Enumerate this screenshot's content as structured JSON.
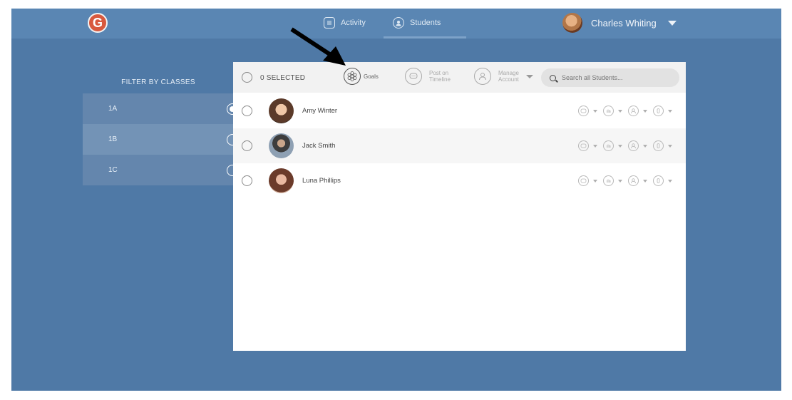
{
  "app": {
    "logo_letter": "G"
  },
  "nav": {
    "activity": {
      "label": "Activity",
      "icon": "list-icon"
    },
    "students": {
      "label": "Students",
      "icon": "user-icon",
      "active": true
    }
  },
  "user": {
    "name": "Charles Whiting"
  },
  "filter": {
    "title": "FILTER BY CLASSES",
    "classes": [
      {
        "label": "1A",
        "selected": true
      },
      {
        "label": "1B",
        "selected": false
      },
      {
        "label": "1C",
        "selected": false
      }
    ]
  },
  "toolbar": {
    "selected_count": "0 SELECTED",
    "goals_label": "Goals",
    "post_label_1": "Post on",
    "post_label_2": "Timeline",
    "manage_label_1": "Manage",
    "manage_label_2": "Account",
    "search_placeholder": "Search all Students..."
  },
  "students": [
    {
      "name": "Amy Winter"
    },
    {
      "name": "Jack Smith"
    },
    {
      "name": "Luna Phillips"
    }
  ],
  "colors": {
    "background": "#4f79a6",
    "topbar": "#5a86b3",
    "logo": "#d8593e"
  }
}
